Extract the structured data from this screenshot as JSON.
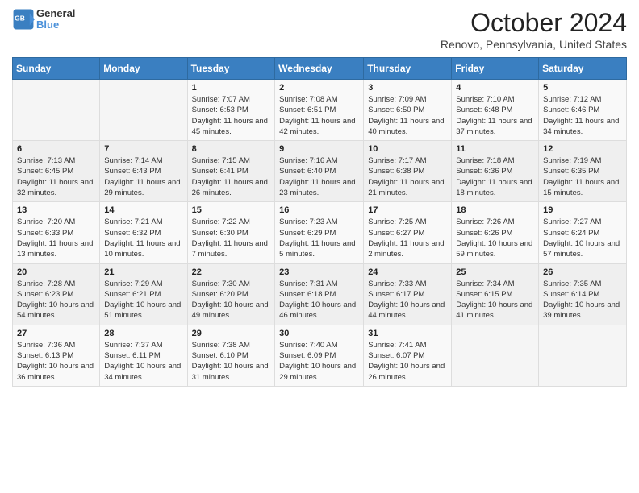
{
  "header": {
    "logo_line1": "General",
    "logo_line2": "Blue",
    "title": "October 2024",
    "subtitle": "Renovo, Pennsylvania, United States"
  },
  "days_of_week": [
    "Sunday",
    "Monday",
    "Tuesday",
    "Wednesday",
    "Thursday",
    "Friday",
    "Saturday"
  ],
  "weeks": [
    [
      {
        "day": "",
        "info": ""
      },
      {
        "day": "",
        "info": ""
      },
      {
        "day": "1",
        "info": "Sunrise: 7:07 AM\nSunset: 6:53 PM\nDaylight: 11 hours and 45 minutes."
      },
      {
        "day": "2",
        "info": "Sunrise: 7:08 AM\nSunset: 6:51 PM\nDaylight: 11 hours and 42 minutes."
      },
      {
        "day": "3",
        "info": "Sunrise: 7:09 AM\nSunset: 6:50 PM\nDaylight: 11 hours and 40 minutes."
      },
      {
        "day": "4",
        "info": "Sunrise: 7:10 AM\nSunset: 6:48 PM\nDaylight: 11 hours and 37 minutes."
      },
      {
        "day": "5",
        "info": "Sunrise: 7:12 AM\nSunset: 6:46 PM\nDaylight: 11 hours and 34 minutes."
      }
    ],
    [
      {
        "day": "6",
        "info": "Sunrise: 7:13 AM\nSunset: 6:45 PM\nDaylight: 11 hours and 32 minutes."
      },
      {
        "day": "7",
        "info": "Sunrise: 7:14 AM\nSunset: 6:43 PM\nDaylight: 11 hours and 29 minutes."
      },
      {
        "day": "8",
        "info": "Sunrise: 7:15 AM\nSunset: 6:41 PM\nDaylight: 11 hours and 26 minutes."
      },
      {
        "day": "9",
        "info": "Sunrise: 7:16 AM\nSunset: 6:40 PM\nDaylight: 11 hours and 23 minutes."
      },
      {
        "day": "10",
        "info": "Sunrise: 7:17 AM\nSunset: 6:38 PM\nDaylight: 11 hours and 21 minutes."
      },
      {
        "day": "11",
        "info": "Sunrise: 7:18 AM\nSunset: 6:36 PM\nDaylight: 11 hours and 18 minutes."
      },
      {
        "day": "12",
        "info": "Sunrise: 7:19 AM\nSunset: 6:35 PM\nDaylight: 11 hours and 15 minutes."
      }
    ],
    [
      {
        "day": "13",
        "info": "Sunrise: 7:20 AM\nSunset: 6:33 PM\nDaylight: 11 hours and 13 minutes."
      },
      {
        "day": "14",
        "info": "Sunrise: 7:21 AM\nSunset: 6:32 PM\nDaylight: 11 hours and 10 minutes."
      },
      {
        "day": "15",
        "info": "Sunrise: 7:22 AM\nSunset: 6:30 PM\nDaylight: 11 hours and 7 minutes."
      },
      {
        "day": "16",
        "info": "Sunrise: 7:23 AM\nSunset: 6:29 PM\nDaylight: 11 hours and 5 minutes."
      },
      {
        "day": "17",
        "info": "Sunrise: 7:25 AM\nSunset: 6:27 PM\nDaylight: 11 hours and 2 minutes."
      },
      {
        "day": "18",
        "info": "Sunrise: 7:26 AM\nSunset: 6:26 PM\nDaylight: 10 hours and 59 minutes."
      },
      {
        "day": "19",
        "info": "Sunrise: 7:27 AM\nSunset: 6:24 PM\nDaylight: 10 hours and 57 minutes."
      }
    ],
    [
      {
        "day": "20",
        "info": "Sunrise: 7:28 AM\nSunset: 6:23 PM\nDaylight: 10 hours and 54 minutes."
      },
      {
        "day": "21",
        "info": "Sunrise: 7:29 AM\nSunset: 6:21 PM\nDaylight: 10 hours and 51 minutes."
      },
      {
        "day": "22",
        "info": "Sunrise: 7:30 AM\nSunset: 6:20 PM\nDaylight: 10 hours and 49 minutes."
      },
      {
        "day": "23",
        "info": "Sunrise: 7:31 AM\nSunset: 6:18 PM\nDaylight: 10 hours and 46 minutes."
      },
      {
        "day": "24",
        "info": "Sunrise: 7:33 AM\nSunset: 6:17 PM\nDaylight: 10 hours and 44 minutes."
      },
      {
        "day": "25",
        "info": "Sunrise: 7:34 AM\nSunset: 6:15 PM\nDaylight: 10 hours and 41 minutes."
      },
      {
        "day": "26",
        "info": "Sunrise: 7:35 AM\nSunset: 6:14 PM\nDaylight: 10 hours and 39 minutes."
      }
    ],
    [
      {
        "day": "27",
        "info": "Sunrise: 7:36 AM\nSunset: 6:13 PM\nDaylight: 10 hours and 36 minutes."
      },
      {
        "day": "28",
        "info": "Sunrise: 7:37 AM\nSunset: 6:11 PM\nDaylight: 10 hours and 34 minutes."
      },
      {
        "day": "29",
        "info": "Sunrise: 7:38 AM\nSunset: 6:10 PM\nDaylight: 10 hours and 31 minutes."
      },
      {
        "day": "30",
        "info": "Sunrise: 7:40 AM\nSunset: 6:09 PM\nDaylight: 10 hours and 29 minutes."
      },
      {
        "day": "31",
        "info": "Sunrise: 7:41 AM\nSunset: 6:07 PM\nDaylight: 10 hours and 26 minutes."
      },
      {
        "day": "",
        "info": ""
      },
      {
        "day": "",
        "info": ""
      }
    ]
  ]
}
